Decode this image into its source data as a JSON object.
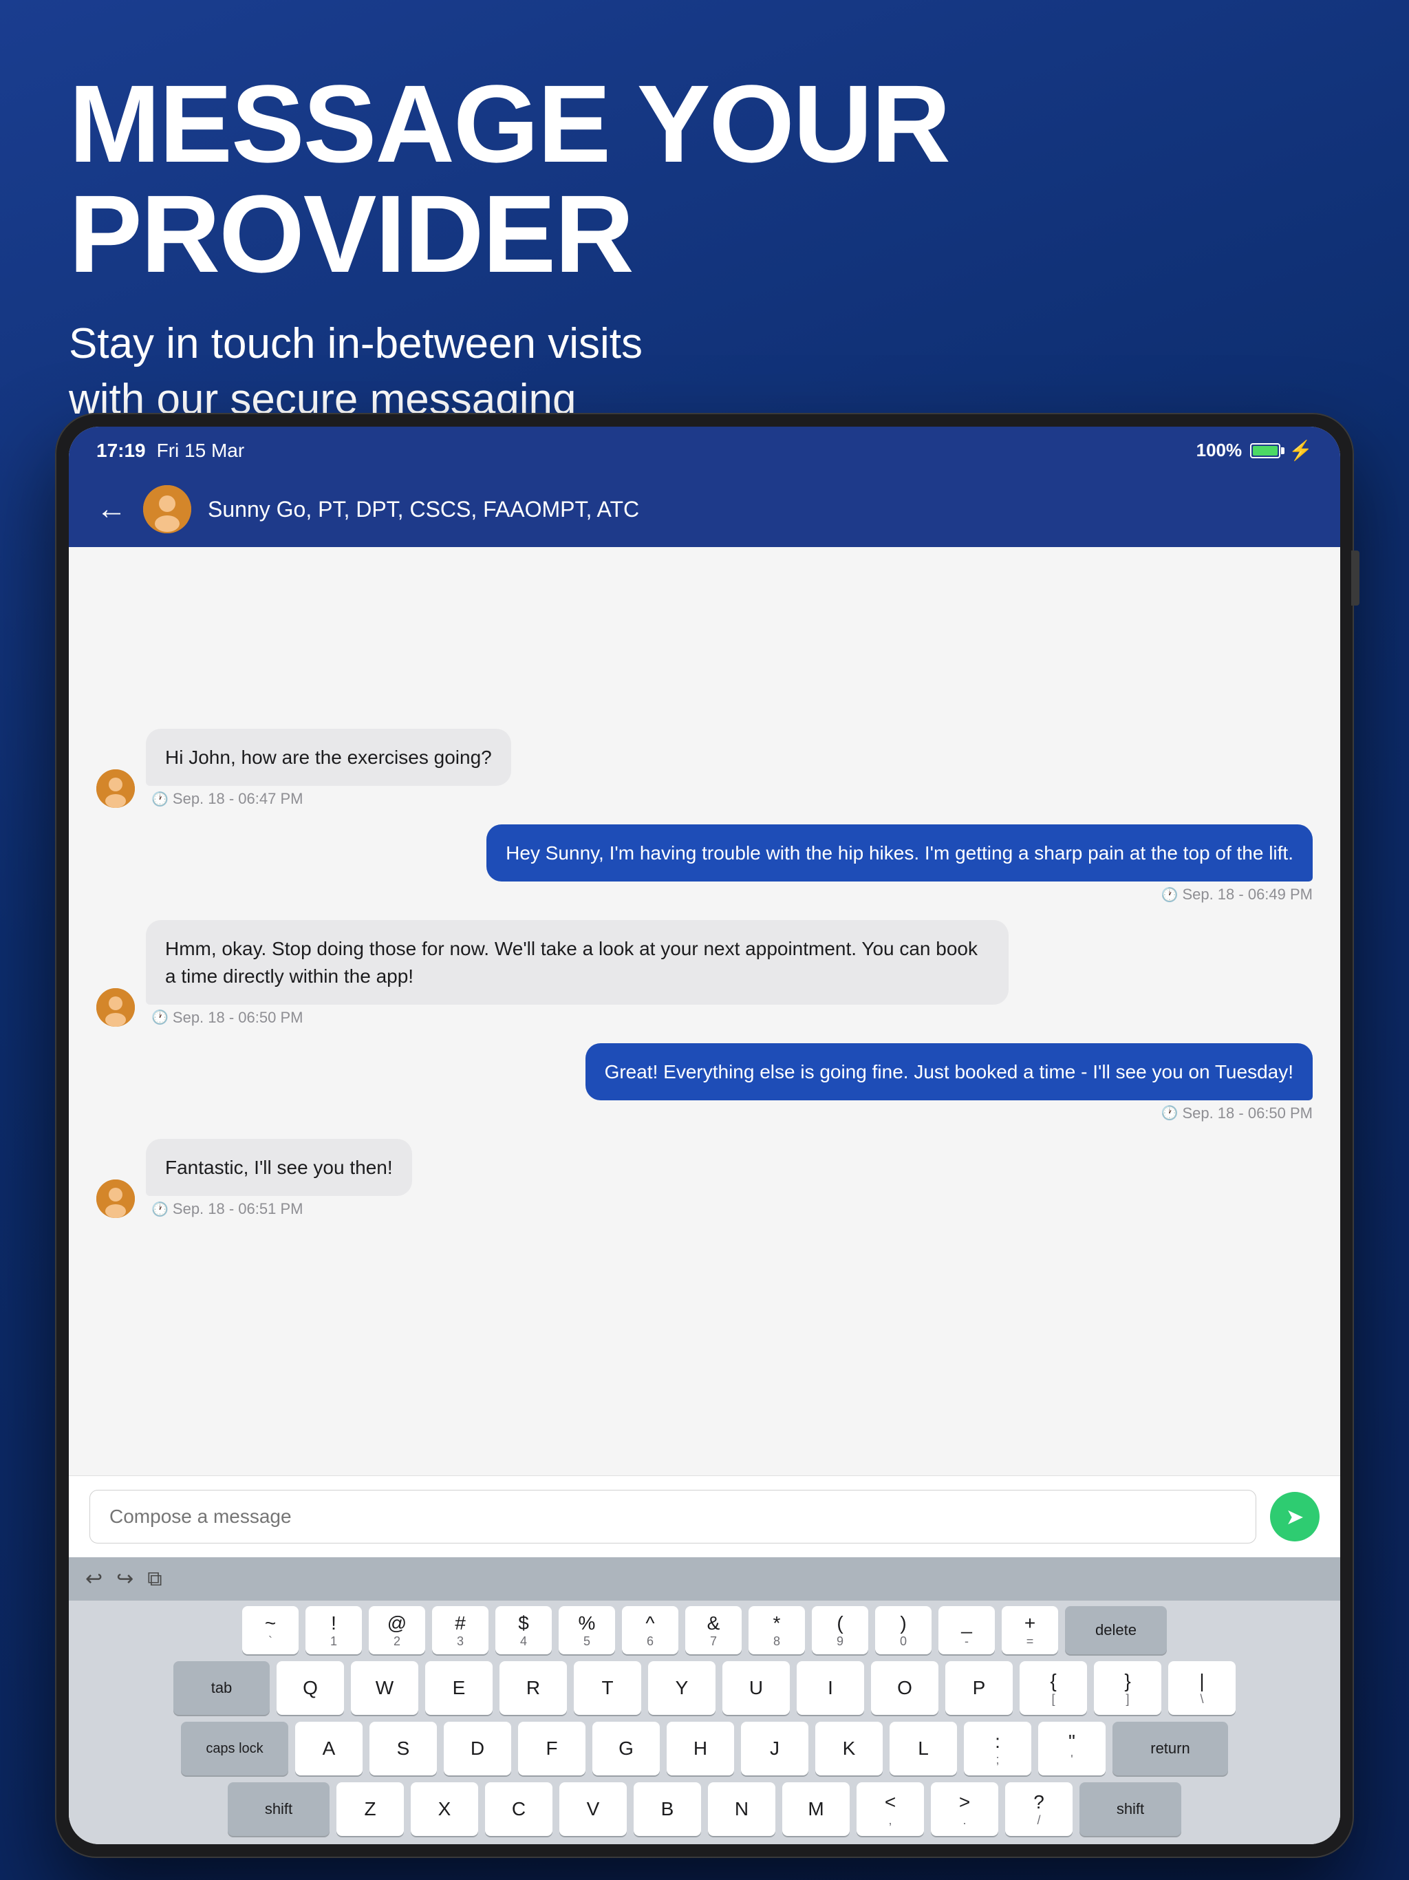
{
  "header": {
    "main_title": "MESSAGE YOUR PROVIDER",
    "subtitle": "Stay in touch in-between visits with our secure messaging system."
  },
  "status_bar": {
    "time": "17:19",
    "date": "Fri 15 Mar",
    "battery": "100%"
  },
  "nav": {
    "provider_name": "Sunny Go, PT, DPT, CSCS, FAAOMPT, ATC"
  },
  "messages": [
    {
      "type": "received",
      "text": "Hi John, how are the exercises going?",
      "time": "Sep. 18 - 06:47 PM",
      "has_avatar": true
    },
    {
      "type": "sent",
      "text": "Hey Sunny, I'm having trouble with the hip hikes. I'm getting a sharp pain at the top of the lift.",
      "time": "Sep. 18 - 06:49 PM",
      "has_avatar": false
    },
    {
      "type": "received",
      "text": "Hmm, okay. Stop doing those for now. We'll take a look at your next appointment. You can book a time directly within the app!",
      "time": "Sep. 18 - 06:50 PM",
      "has_avatar": true
    },
    {
      "type": "sent",
      "text": "Great! Everything else is going fine. Just booked a time - I'll see you on Tuesday!",
      "time": "Sep. 18 - 06:50 PM",
      "has_avatar": false
    },
    {
      "type": "received",
      "text": "Fantastic, I'll see you then!",
      "time": "Sep. 18 - 06:51 PM",
      "has_avatar": true
    }
  ],
  "compose": {
    "placeholder": "Compose a message"
  },
  "keyboard": {
    "toolbar_buttons": [
      "undo",
      "redo",
      "clipboard"
    ],
    "row1": [
      {
        "main": "~",
        "sub": "`"
      },
      {
        "main": "!",
        "sub": "1"
      },
      {
        "main": "@",
        "sub": "2"
      },
      {
        "main": "#",
        "sub": "3"
      },
      {
        "main": "$",
        "sub": "4"
      },
      {
        "main": "%",
        "sub": "5"
      },
      {
        "main": "^",
        "sub": "6"
      },
      {
        "main": "&",
        "sub": "7"
      },
      {
        "main": "*",
        "sub": "8"
      },
      {
        "main": "(",
        "sub": "9"
      },
      {
        "main": ")",
        "sub": "0"
      },
      {
        "main": "_",
        "sub": "-"
      },
      {
        "main": "+",
        "sub": "="
      },
      {
        "main": "delete",
        "sub": ""
      }
    ],
    "row2": [
      "Q",
      "W",
      "E",
      "R",
      "T",
      "Y",
      "U",
      "I",
      "O",
      "P",
      "{[",
      "}\\ ]",
      "|\\"
    ],
    "row2_special": [
      {
        "label": "tab"
      },
      "Q",
      "W",
      "E",
      "R",
      "T",
      "Y",
      "U",
      "I",
      "O",
      "P",
      {
        "main": "{",
        "sub": "["
      },
      {
        "main": "}",
        "sub": "]"
      },
      {
        "main": "|",
        "sub": "\\"
      }
    ],
    "row3_special": [
      {
        "label": "caps lock"
      },
      "A",
      "S",
      "D",
      "F",
      "G",
      "H",
      "J",
      "K",
      "L",
      {
        "main": ":",
        "sub": ";"
      },
      {
        "main": "\"",
        "sub": "'"
      },
      {
        "label": "return"
      }
    ],
    "row4_special": [
      {
        "label": "shift"
      },
      "Z",
      "X",
      "C",
      "V",
      "B",
      "N",
      "M",
      {
        "main": "<",
        "sub": ","
      },
      {
        "main": ">",
        "sub": "."
      },
      {
        "main": "?",
        "sub": "/"
      },
      {
        "label": "shift"
      }
    ]
  }
}
